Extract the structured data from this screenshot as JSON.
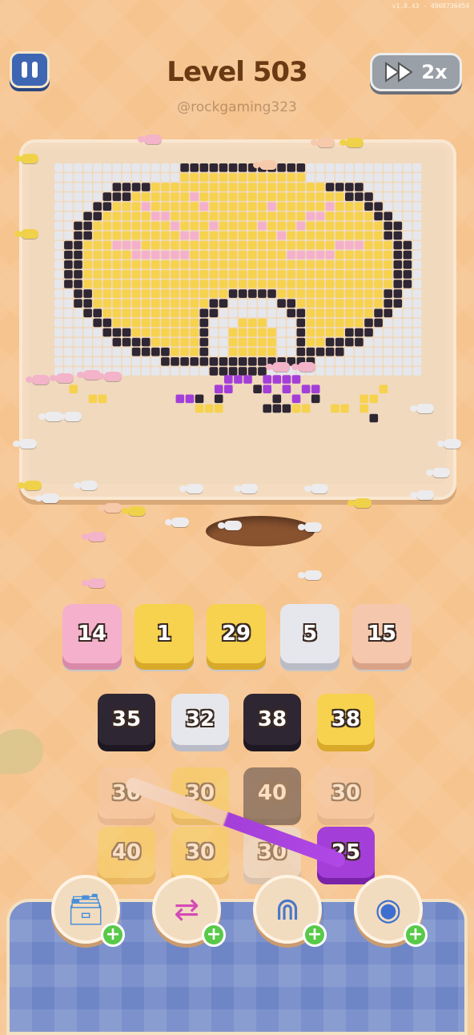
{
  "build_version": "v1.0.43 - 4908736454",
  "level_title": "Level 503",
  "watermark": "@rockgaming323",
  "speed_label": "2x",
  "colors": {
    "black": "#2e2633",
    "white": "#e6e7ec",
    "yellow": "#f6d24e",
    "pink": "#f5b0cc",
    "peach": "#f5c8ad",
    "purple": "#a33fd8"
  },
  "queue_tiles": [
    {
      "value": "14",
      "color": "pink"
    },
    {
      "value": "1",
      "color": "yellow"
    },
    {
      "value": "29",
      "color": "yellow"
    },
    {
      "value": "5",
      "color": "white"
    },
    {
      "value": "15",
      "color": "peach"
    }
  ],
  "grid_tiles": [
    {
      "value": "35",
      "color": "black",
      "faded": false
    },
    {
      "value": "32",
      "color": "white",
      "faded": false
    },
    {
      "value": "38",
      "color": "black",
      "faded": false
    },
    {
      "value": "38",
      "color": "yellow",
      "faded": false
    },
    {
      "value": "30",
      "color": "peach",
      "faded": true
    },
    {
      "value": "30",
      "color": "yellow",
      "faded": true
    },
    {
      "value": "40",
      "color": "black",
      "faded": true
    },
    {
      "value": "30",
      "color": "peach",
      "faded": true
    },
    {
      "value": "40",
      "color": "yellow",
      "faded": true
    },
    {
      "value": "30",
      "color": "yellow",
      "faded": true
    },
    {
      "value": "30",
      "color": "white",
      "faded": true
    },
    {
      "value": "25",
      "color": "purple",
      "faded": false
    }
  ],
  "boosters": [
    {
      "name": "add-slot-booster-icon",
      "glyph": "🗃"
    },
    {
      "name": "shuffle-booster-icon",
      "glyph": "⇄"
    },
    {
      "name": "magnet-booster-icon",
      "glyph": "⋒"
    },
    {
      "name": "spool-booster-icon",
      "glyph": "◉"
    }
  ],
  "booster_plus": "+"
}
